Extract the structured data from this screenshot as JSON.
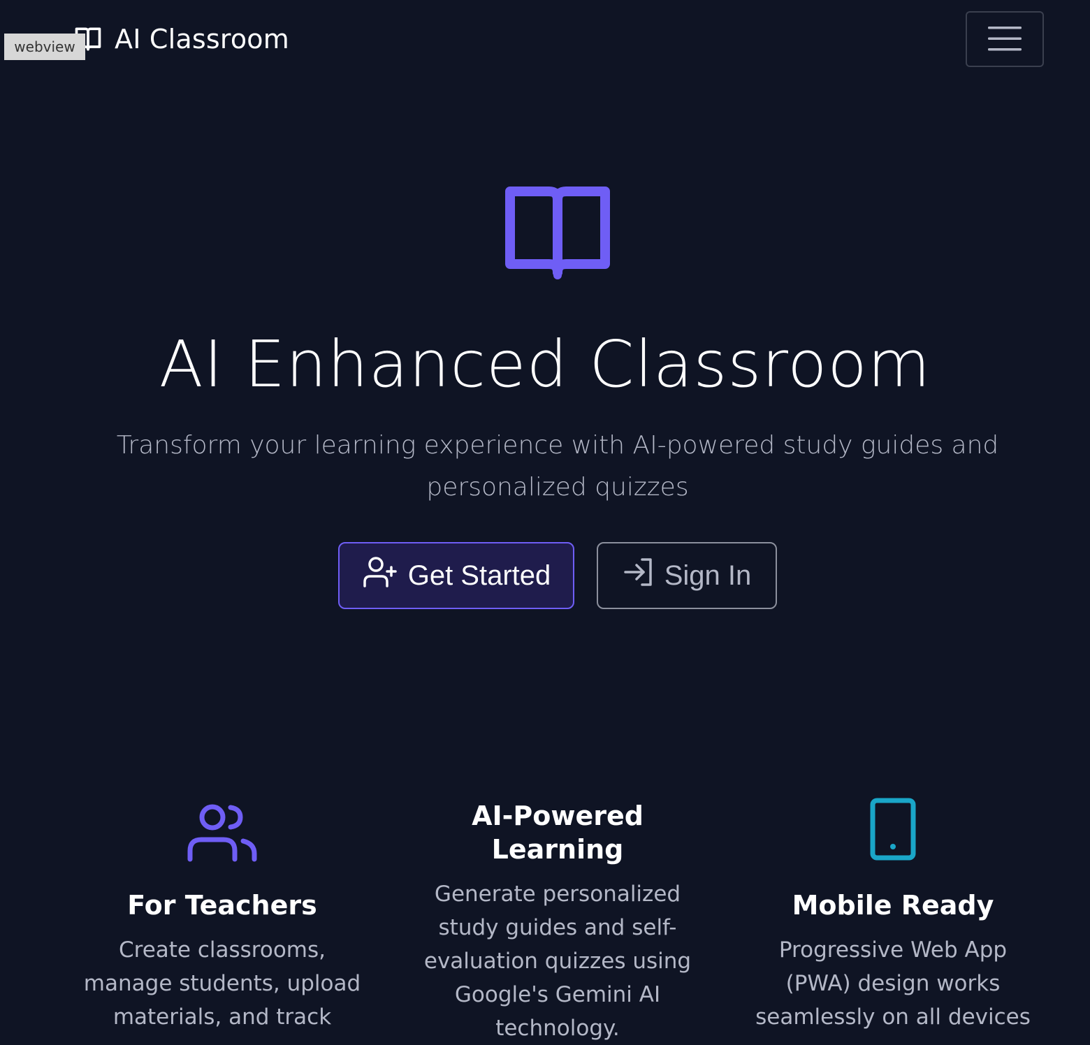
{
  "webview_tag": "webview",
  "navbar": {
    "brand": "AI Classroom",
    "brand_icon": "book-icon",
    "menu_icon": "hamburger-menu-icon"
  },
  "hero": {
    "icon": "book-open-icon",
    "title": "AI Enhanced Classroom",
    "subtitle": "Transform your learning experience with AI-powered study guides and personalized quizzes",
    "primary_button": {
      "label": "Get Started",
      "icon": "user-plus-icon"
    },
    "secondary_button": {
      "label": "Sign In",
      "icon": "sign-in-icon"
    }
  },
  "features": [
    {
      "icon": "users-icon",
      "title": "For Teachers",
      "description": "Create classrooms, manage students, upload materials, and track"
    },
    {
      "icon": "",
      "title": "AI-Powered Learning",
      "description": "Generate personalized study guides and self-evaluation quizzes using Google's Gemini AI technology."
    },
    {
      "icon": "tablet-icon",
      "title": "Mobile Ready",
      "description": "Progressive Web App (PWA) design works seamlessly on all devices"
    }
  ],
  "colors": {
    "background": "#0f1424",
    "accent": "#6f5ef5",
    "text_muted": "#b4b8c7",
    "mobile_icon": "#1aa6c8",
    "primary_button_bg": "#1f1c4c"
  }
}
